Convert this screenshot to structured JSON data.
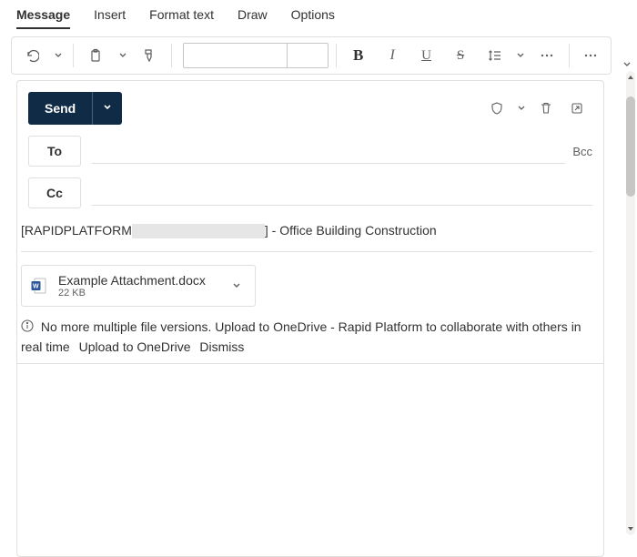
{
  "tabs": {
    "items": [
      "Message",
      "Insert",
      "Format text",
      "Draw",
      "Options"
    ],
    "active_index": 0
  },
  "toolbar": {
    "undo": "undo",
    "paste": "paste",
    "format_painter": "format-painter",
    "font_name": "",
    "font_size": "",
    "bold": "B",
    "italic": "I",
    "underline": "U",
    "strike": "S"
  },
  "send": {
    "label": "Send"
  },
  "recipients": {
    "to_label": "To",
    "cc_label": "Cc",
    "bcc_label": "Bcc"
  },
  "subject": {
    "prefix": "[RAPIDPLATFORM",
    "suffix": "] - Office Building Construction"
  },
  "attachment": {
    "name": "Example Attachment.docx",
    "size": "22 KB"
  },
  "infobar": {
    "text_a": "No more multiple file versions. Upload to OneDrive - Rapid Platform to collaborate with others in real time",
    "upload_label": "Upload to OneDrive",
    "dismiss_label": "Dismiss"
  }
}
